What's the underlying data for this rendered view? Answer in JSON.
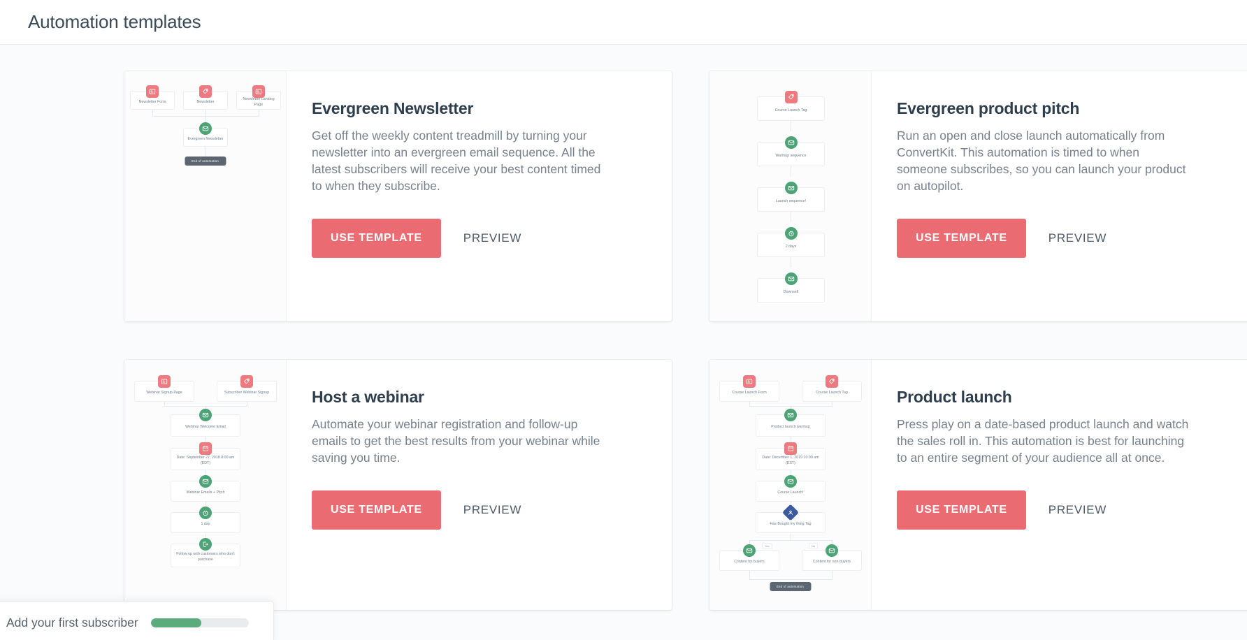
{
  "header": {
    "title": "Automation templates"
  },
  "theme": {
    "accent": "#eb6b73",
    "node_red": "#ee7a7f",
    "node_green": "#4ca375",
    "node_blue": "#3d5a9e",
    "progress_green": "#5cab7c",
    "page_bg": "#fafbfc"
  },
  "actions": {
    "use_template": "USE TEMPLATE",
    "preview": "PREVIEW"
  },
  "checklist": {
    "label": "Add your first subscriber",
    "progress_percent": 52
  },
  "templates": [
    {
      "id": "evergreen-newsletter",
      "name": "Evergreen Newsletter",
      "description": "Get off the weekly content treadmill by turning your newsletter into an evergreen email sequence. All the latest subscribers will receive your best content timed to when they subscribe.",
      "use_template_label": "USE TEMPLATE",
      "preview_label": "PREVIEW",
      "flow": {
        "end_chip": "End of automation",
        "nodes": [
          {
            "label": "Newsletter Form",
            "icon": "form-icon",
            "kind": "red"
          },
          {
            "label": "Newsletter",
            "icon": "tag-icon",
            "kind": "red"
          },
          {
            "label": "Newsletter Landing Page",
            "icon": "form-icon",
            "kind": "red"
          },
          {
            "label": "Evergreen Newsletter",
            "icon": "email-icon",
            "kind": "green"
          }
        ]
      }
    },
    {
      "id": "evergreen-product-pitch",
      "name": "Evergreen product pitch",
      "description": "Run an open and close launch automatically from ConvertKit. This automation is timed to when someone subscribes, so you can launch your product on autopilot.",
      "use_template_label": "USE TEMPLATE",
      "preview_label": "PREVIEW",
      "flow": {
        "end_chip": "",
        "nodes": [
          {
            "label": "Course Launch Tag",
            "icon": "tag-icon",
            "kind": "red"
          },
          {
            "label": "Warmup sequence",
            "icon": "email-icon",
            "kind": "green"
          },
          {
            "label": "Launch sequence!",
            "icon": "email-icon",
            "kind": "green"
          },
          {
            "label": "2 days",
            "icon": "clock-icon",
            "kind": "green"
          },
          {
            "label": "Downsell",
            "icon": "email-icon",
            "kind": "green"
          }
        ]
      }
    },
    {
      "id": "host-a-webinar",
      "name": "Host a webinar",
      "description": "Automate your webinar registration and follow-up emails to get the best results from your webinar while saving you time.",
      "use_template_label": "USE TEMPLATE",
      "preview_label": "PREVIEW",
      "flow": {
        "end_chip": "",
        "nodes": [
          {
            "label": "Webinar Signup Page",
            "icon": "form-icon",
            "kind": "red"
          },
          {
            "label": "Subscriber Webinar Signup",
            "icon": "tag-icon",
            "kind": "red"
          },
          {
            "label": "Webinar Welcome Email",
            "icon": "email-icon",
            "kind": "green"
          },
          {
            "label": "Date: September 27, 2018 8:00 am (EDT)",
            "icon": "calendar-icon",
            "kind": "red"
          },
          {
            "label": "Webinar Emails + Pitch",
            "icon": "email-icon",
            "kind": "green"
          },
          {
            "label": "1 day",
            "icon": "clock-icon",
            "kind": "green"
          },
          {
            "label": "Follow up with customers who don't purchase",
            "icon": "exit-icon",
            "kind": "green"
          }
        ]
      }
    },
    {
      "id": "product-launch",
      "name": "Product launch",
      "description": "Press play on a date-based product launch and watch the sales roll in. This automation is best for launching to an entire segment of your audience all at once.",
      "use_template_label": "USE TEMPLATE",
      "preview_label": "PREVIEW",
      "flow": {
        "end_chip": "End of automation",
        "branch_yes": "Yes",
        "branch_no": "No",
        "nodes": [
          {
            "label": "Course Launch Form",
            "icon": "form-icon",
            "kind": "red"
          },
          {
            "label": "Course Launch Tag",
            "icon": "tag-icon",
            "kind": "red"
          },
          {
            "label": "Product launch warmup",
            "icon": "email-icon",
            "kind": "green"
          },
          {
            "label": "Date: December 1, 2019 10:00 am (EST)",
            "icon": "calendar-icon",
            "kind": "red"
          },
          {
            "label": "Course Launch!",
            "icon": "email-icon",
            "kind": "green"
          },
          {
            "label": "Has Bought my thing Tag",
            "icon": "condition-icon",
            "kind": "blue"
          },
          {
            "label": "Content for buyers",
            "icon": "email-icon",
            "kind": "green"
          },
          {
            "label": "Content for non-buyers",
            "icon": "email-icon",
            "kind": "green"
          }
        ]
      }
    }
  ]
}
